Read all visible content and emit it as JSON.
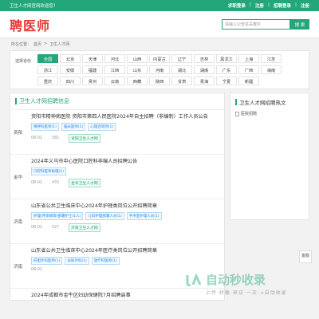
{
  "topbar": {
    "welcome": "卫生人才网官网欢迎您！",
    "login": "求职登录",
    "sep": "|",
    "register": "注册",
    "employer_login": "招聘登录",
    "employer_register": "注册"
  },
  "header": {
    "logo": "聘医师"
  },
  "search": {
    "placeholder": "请输入公告名关键字",
    "button": "搜 索"
  },
  "breadcrumb": {
    "prefix": "所在位置：",
    "home": "首页",
    "arrow": ">",
    "current": "卫生人才网"
  },
  "filter": {
    "label": "选择省份",
    "provinces": [
      "全国",
      "北京",
      "天津",
      "河北",
      "山西",
      "内蒙古",
      "辽宁",
      "吉林",
      "黑龙江",
      "上海",
      "江苏",
      "浙江",
      "安徽",
      "福建",
      "江西",
      "山东",
      "河南",
      "湖北",
      "湖南",
      "广东",
      "广西",
      "海南",
      "重庆",
      "四川",
      "贵州",
      "云南",
      "西藏",
      "陕西",
      "甘肃",
      "青海",
      "宁夏",
      "新疆"
    ],
    "active": "全国"
  },
  "list": {
    "title": "卫生人才网招聘信息",
    "jobs": [
      {
        "loc": "资阳",
        "title": "资阳市精神病医院 资阳市第四人民医院2024年自主招聘（非编制）工作人员公告",
        "tags": [
          "精神科医师(1)",
          "临床医师(1)",
          "心理咨询师(1)"
        ],
        "date": "08-01",
        "views": "582",
        "label": "资阳卫生人才网"
      },
      {
        "loc": "金华",
        "title": "2024年义乌市中心医院口腔科非编人员招聘公告",
        "tags": [
          "口腔科医师助理(1)"
        ],
        "date": "08-01",
        "views": "433",
        "label": "金华卫生人才网"
      },
      {
        "loc": "济南",
        "title": "山东省公共卫生临床中心2024年护理类岗位公开招聘简章",
        "tags": [
          "护理(传染病等)部署护士(1人)",
          "儿科护理部署人员(1)",
          "手术室护理人员(1)"
        ],
        "date": "08-01",
        "views": "527",
        "label": "济南卫生人才网"
      },
      {
        "loc": "济南",
        "title": "山东省公共卫生临床中心2024年医疗类岗位公开招聘简章",
        "tags": [
          "肝胆外科医师(1)",
          "泌尿外科(1)",
          "放疗科医师(1)"
        ],
        "date": "08-01",
        "views": "",
        "label": ""
      },
      {
        "loc": "",
        "title": "2024年成都市金牛区妇幼保健院7月招聘启事",
        "tags": [],
        "date": "",
        "views": "",
        "label": ""
      }
    ]
  },
  "right": {
    "title": "卫生人才网招聘热文",
    "img_alt": "医院招聘"
  },
  "float": {
    "label": "客服"
  },
  "watermark": {
    "main": "自动秒收录",
    "sub": "上传·转载·来访·一次·→自动收录"
  }
}
